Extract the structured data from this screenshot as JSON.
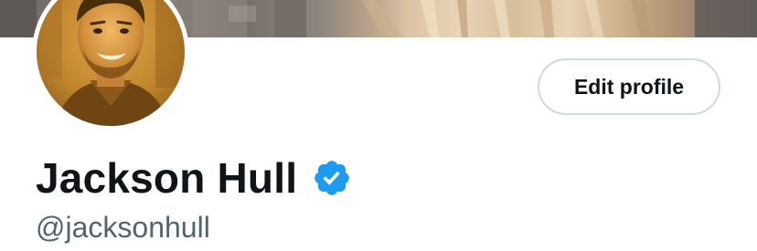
{
  "profile": {
    "display_name": "Jackson Hull",
    "handle": "@jacksonhull",
    "verified": true,
    "edit_button_label": "Edit profile"
  },
  "icons": {
    "verified": "verified-badge-icon"
  },
  "colors": {
    "verified_blue": "#1d9bf0",
    "name_text": "#0f1419",
    "handle_text": "#536471",
    "button_border": "#cfd9de",
    "avatar_tone": "#c98a2e"
  }
}
